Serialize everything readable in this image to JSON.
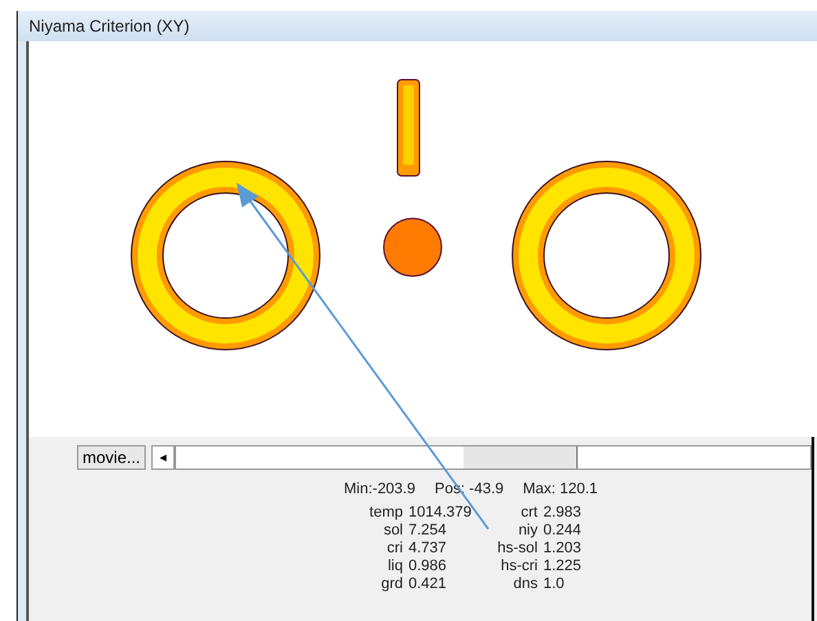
{
  "window": {
    "title": "Niyama Criterion (XY)"
  },
  "controls": {
    "movie_button": "movie...",
    "scroll_left": "◂"
  },
  "range": {
    "min": "Min:-203.9",
    "pos": "Pos: -43.9",
    "max": "Max: 120.1"
  },
  "readouts": [
    {
      "left": {
        "label": "temp",
        "value": "1014.379"
      },
      "right": {
        "label": "crt",
        "value": "2.983"
      }
    },
    {
      "left": {
        "label": "sol",
        "value": "7.254"
      },
      "right": {
        "label": "niy",
        "value": "0.244"
      }
    },
    {
      "left": {
        "label": "cri",
        "value": "4.737"
      },
      "right": {
        "label": "hs-sol",
        "value": "1.203"
      }
    },
    {
      "left": {
        "label": "liq",
        "value": "0.986"
      },
      "right": {
        "label": "hs-cri",
        "value": "1.225"
      }
    },
    {
      "left": {
        "label": "grd",
        "value": "0.421"
      },
      "right": {
        "label": "dns",
        "value": "1.0"
      }
    }
  ]
}
